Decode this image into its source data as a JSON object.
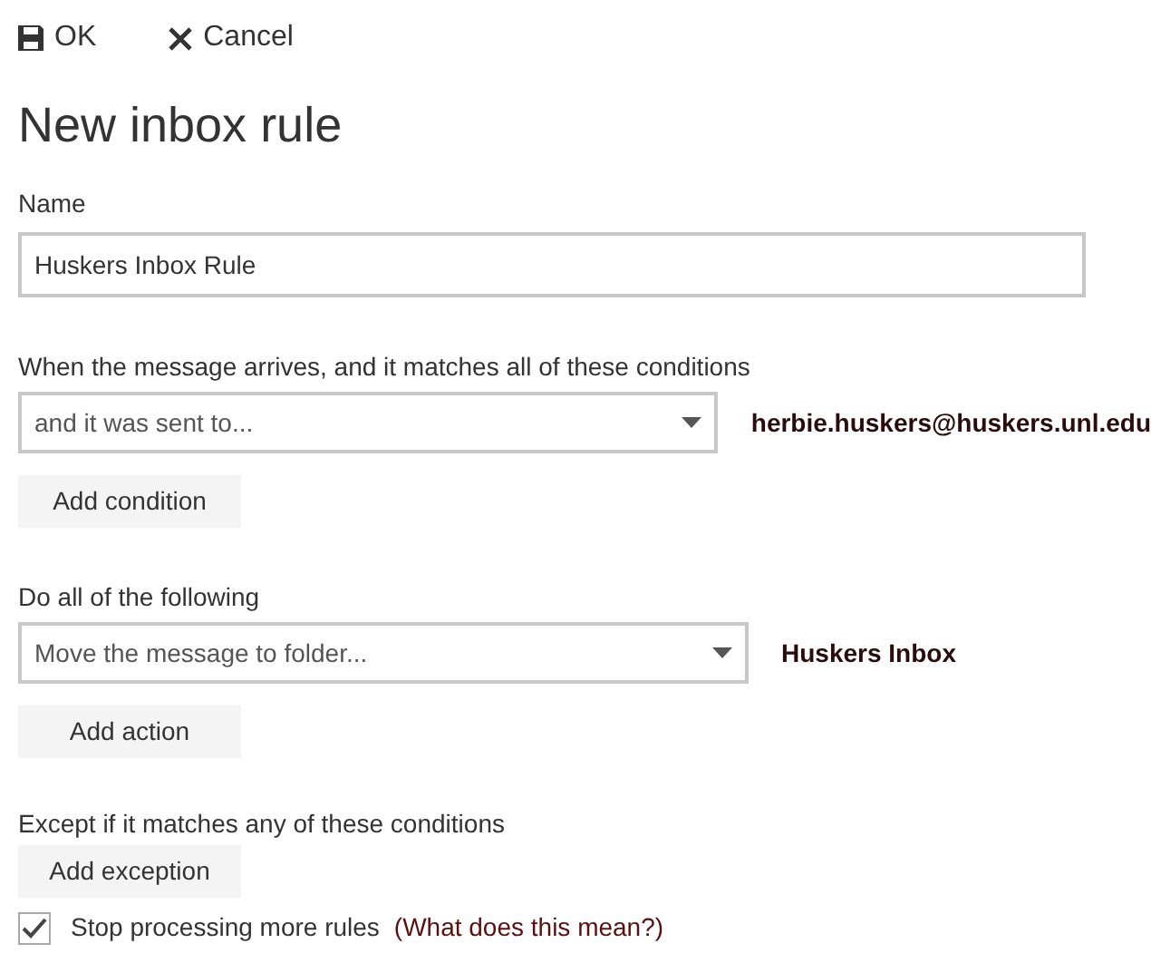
{
  "toolbar": [
    {
      "kind": "save",
      "label": "OK"
    },
    {
      "kind": "cancel",
      "label": "Cancel"
    }
  ],
  "title": "New inbox rule",
  "name_field": {
    "label": "Name",
    "value": "Huskers Inbox Rule"
  },
  "sections": [
    {
      "label": "When the message arrives, and it matches all of these conditions",
      "dropdown": "and it was sent to...",
      "value": "herbie.huskers@huskers.unl.edu",
      "button": "Add condition"
    },
    {
      "label": "Do all of the following",
      "dropdown": "Move the message to folder...",
      "value": "Huskers Inbox",
      "button": "Add action"
    },
    {
      "label": "Except if it matches any of these conditions",
      "button": "Add exception"
    }
  ],
  "stop_rules": {
    "label": "Stop processing more rules",
    "checked": true,
    "link": "(What does this mean?)"
  }
}
